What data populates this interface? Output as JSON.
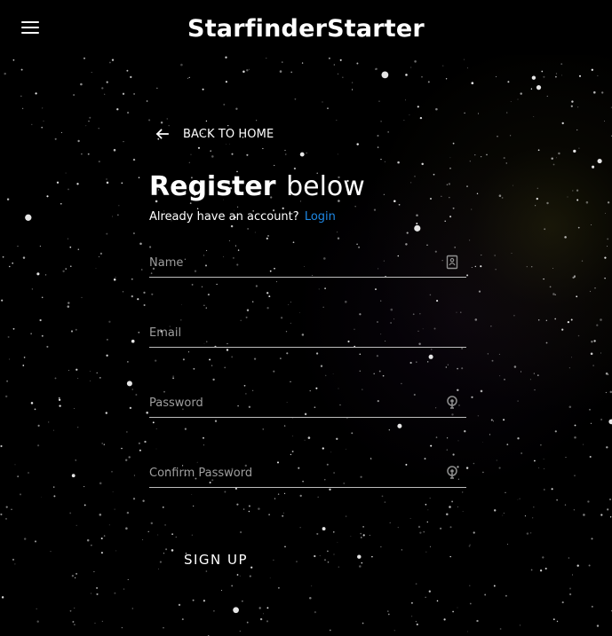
{
  "header": {
    "menu_icon": "menu-icon",
    "title": "StarfinderStarter"
  },
  "back": {
    "icon": "arrow-left-icon",
    "label": "BACK TO HOME"
  },
  "register": {
    "heading_strong": "Register",
    "heading_light": "below",
    "prompt": "Already have an account?",
    "login_link": "Login"
  },
  "form": {
    "fields": [
      {
        "placeholder": "Name",
        "value": "",
        "icon": "contact-card-icon"
      },
      {
        "placeholder": "Email",
        "value": "",
        "icon": ""
      },
      {
        "placeholder": "Password",
        "value": "",
        "icon": "password-key-icon"
      },
      {
        "placeholder": "Confirm Password",
        "value": "",
        "icon": "password-key-icon"
      }
    ],
    "submit_label": "SIGN UP"
  },
  "colors": {
    "background": "#000000",
    "text": "#ffffff",
    "link": "#1e88e5",
    "field_line": "#bdbdbd",
    "placeholder": "#9e9e9e",
    "icon_gray": "#8f8f8f"
  }
}
